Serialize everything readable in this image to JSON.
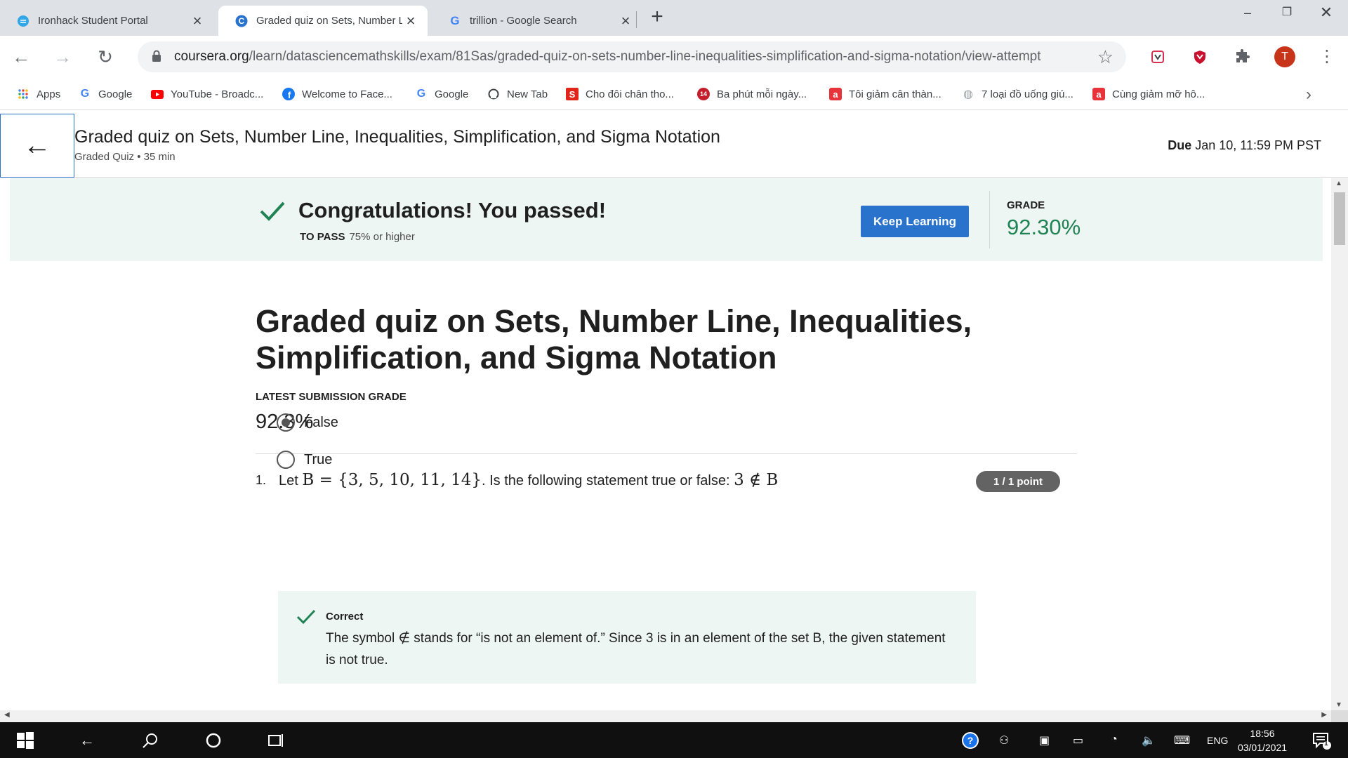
{
  "browser": {
    "tabs": [
      {
        "title": "Ironhack Student Portal",
        "active": false
      },
      {
        "title": "Graded quiz on Sets, Number Line",
        "active": true
      },
      {
        "title": "trillion - Google Search",
        "active": false
      }
    ],
    "url_host": "coursera.org",
    "url_path": "/learn/datasciencemathskills/exam/81Sas/graded-quiz-on-sets-number-line-inequalities-simplification-and-sigma-notation/view-attempt",
    "profile_initial": "T",
    "bookmarks": [
      "Apps",
      "Google",
      "YouTube - Broadc...",
      "Welcome to Face...",
      "Google",
      "New Tab",
      "Cho đôi chân tho...",
      "Ba phút mỗi ngày...",
      "Tôi giảm cân thàn...",
      "7 loại đồ uống giú...",
      "Cùng giảm mỡ hô..."
    ]
  },
  "header": {
    "title": "Graded quiz on Sets, Number Line, Inequalities, Simplification, and Sigma Notation",
    "subtitle": "Graded Quiz • 35 min",
    "due_label": "Due",
    "due_value": "Jan 10, 11:59 PM PST"
  },
  "banner": {
    "message": "Congratulations! You passed!",
    "to_pass_label": "TO PASS",
    "to_pass_value": "75% or higher",
    "button": "Keep Learning",
    "grade_label": "GRADE",
    "grade_value": "92.30%"
  },
  "quiz": {
    "title": "Graded quiz on Sets, Number Line, Inequalities, Simplification, and Sigma Notation",
    "latest_label": "LATEST SUBMISSION GRADE",
    "latest_value": "92.3%"
  },
  "question": {
    "number": "1.",
    "text_before": "Let",
    "math_set": "B = {3, 5, 10, 11, 14}",
    "text_after": ". Is the following statement true or false:",
    "math_statement": "3 ∉ B",
    "points": "1 / 1 point",
    "options": [
      {
        "label": "False",
        "selected": true
      },
      {
        "label": "True",
        "selected": false
      }
    ],
    "feedback_label": "Correct",
    "feedback_text": "The symbol ∉ stands for “is not an element of.” Since 3 is in an element of the set B, the given statement is not true."
  },
  "taskbar": {
    "language": "ENG",
    "time": "18:56",
    "date": "03/01/2021",
    "notification_count": "1"
  },
  "colors": {
    "accent": "#2a73cc",
    "success": "#1f8354",
    "banner_bg": "#eef6f4"
  }
}
